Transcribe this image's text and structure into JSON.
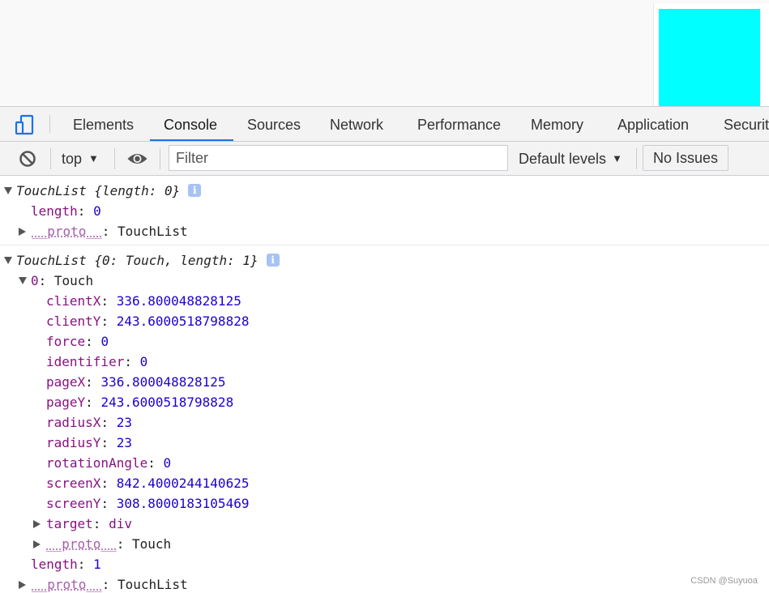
{
  "page": {
    "box_color": "#00ffff"
  },
  "tabs": [
    {
      "label": "Elements"
    },
    {
      "label": "Console",
      "active": true
    },
    {
      "label": "Sources"
    },
    {
      "label": "Network"
    },
    {
      "label": "Performance"
    },
    {
      "label": "Memory"
    },
    {
      "label": "Application"
    },
    {
      "label": "Securit"
    }
  ],
  "toolbar": {
    "context": "top",
    "filter_placeholder": "Filter",
    "levels": "Default levels",
    "issues": "No Issues"
  },
  "console": {
    "msg1": {
      "summary": "TouchList {length: 0}",
      "length_key": "length",
      "length_val": "0",
      "proto_key": "__proto__",
      "proto_val": "TouchList"
    },
    "msg2": {
      "summary": "TouchList {0: Touch, length: 1}",
      "item_key": "0",
      "item_val": "Touch",
      "props": [
        {
          "key": "clientX",
          "value": "336.800048828125"
        },
        {
          "key": "clientY",
          "value": "243.6000518798828"
        },
        {
          "key": "force",
          "value": "0"
        },
        {
          "key": "identifier",
          "value": "0"
        },
        {
          "key": "pageX",
          "value": "336.800048828125"
        },
        {
          "key": "pageY",
          "value": "243.6000518798828"
        },
        {
          "key": "radiusX",
          "value": "23"
        },
        {
          "key": "radiusY",
          "value": "23"
        },
        {
          "key": "rotationAngle",
          "value": "0"
        },
        {
          "key": "screenX",
          "value": "842.4000244140625"
        },
        {
          "key": "screenY",
          "value": "308.8000183105469"
        }
      ],
      "target_key": "target",
      "target_val": "div",
      "item_proto_key": "__proto__",
      "item_proto_val": "Touch",
      "length_key": "length",
      "length_val": "1",
      "proto_key": "__proto__",
      "proto_val": "TouchList"
    }
  },
  "watermark": "CSDN @Suyuoa",
  "colors": {
    "accent": "#1a73e8",
    "key": "#881280",
    "number": "#1c00cf"
  }
}
